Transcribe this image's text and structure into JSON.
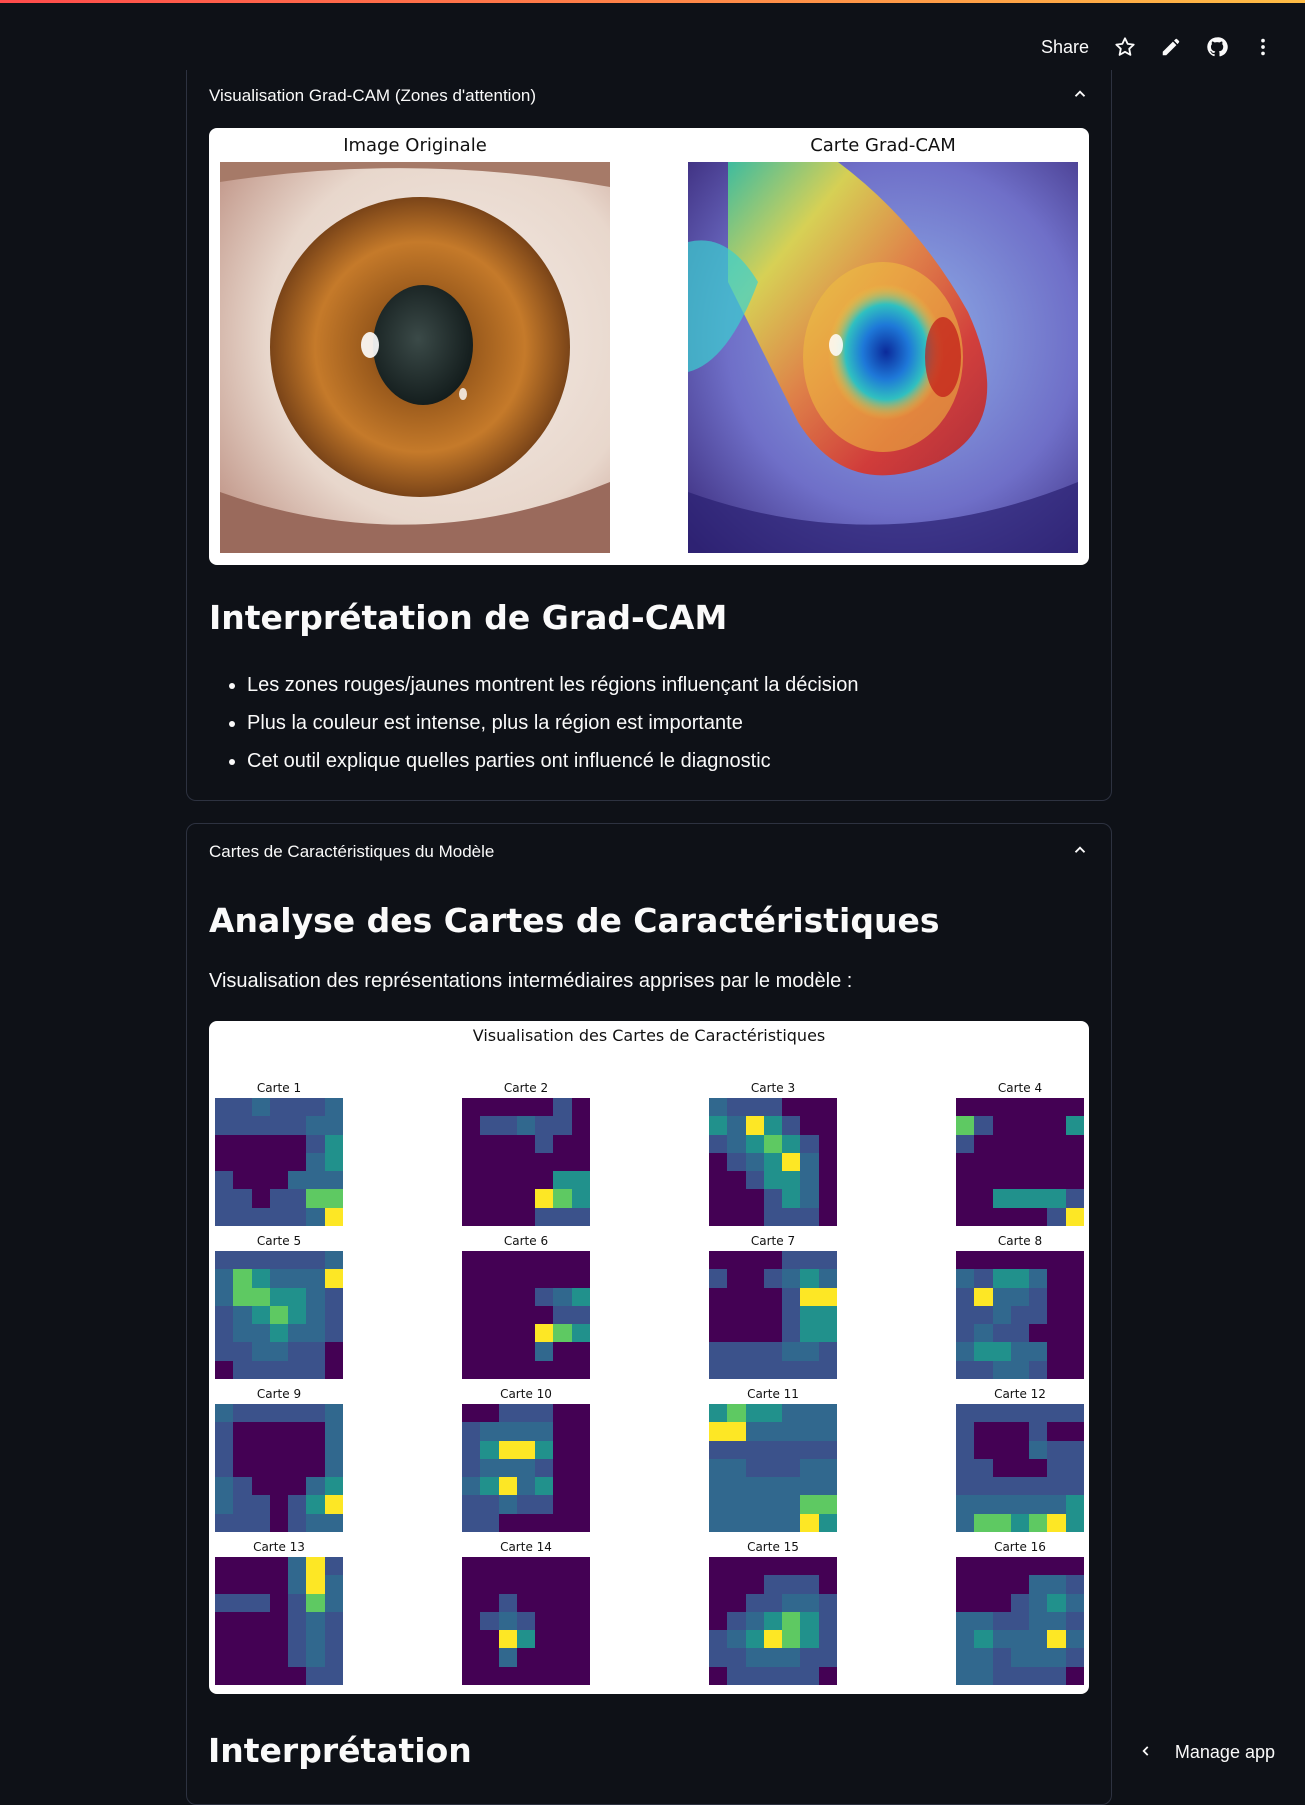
{
  "toolbar": {
    "share_label": "Share",
    "icons": [
      "star-icon",
      "pencil-icon",
      "github-icon",
      "more-vertical-icon"
    ]
  },
  "gradcam_expander": {
    "header": "Visualisation Grad-CAM (Zones d'attention)",
    "figure": {
      "left_title": "Image Originale",
      "right_title": "Carte Grad-CAM"
    },
    "heading": "Interprétation de Grad-CAM",
    "bullets": [
      "Les zones rouges/jaunes montrent les régions influençant la décision",
      "Plus la couleur est intense, plus la région est importante",
      "Cet outil explique quelles parties ont influencé le diagnostic"
    ]
  },
  "features_expander": {
    "header": "Cartes de Caractéristiques du Modèle",
    "heading": "Analyse des Cartes de Caractéristiques",
    "description": "Visualisation des représentations intermédiaires apprises par le modèle :",
    "figure_title": "Visualisation des Cartes de Caractéristiques",
    "maps": [
      {
        "label": "Carte 1",
        "cells": [
          1,
          1,
          2,
          1,
          1,
          1,
          2,
          1,
          1,
          1,
          1,
          1,
          2,
          2,
          0,
          0,
          0,
          0,
          0,
          1,
          3,
          0,
          0,
          0,
          0,
          0,
          2,
          3,
          1,
          0,
          0,
          0,
          2,
          2,
          2,
          1,
          1,
          0,
          1,
          1,
          4,
          4,
          1,
          1,
          1,
          1,
          1,
          2,
          5
        ]
      },
      {
        "label": "Carte 2",
        "cells": [
          0,
          0,
          0,
          0,
          0,
          1,
          0,
          0,
          1,
          1,
          2,
          1,
          1,
          0,
          0,
          0,
          0,
          0,
          1,
          0,
          0,
          0,
          0,
          0,
          0,
          0,
          0,
          0,
          0,
          0,
          0,
          0,
          0,
          3,
          3,
          0,
          0,
          0,
          0,
          5,
          4,
          3,
          0,
          0,
          0,
          0,
          1,
          1,
          1
        ]
      },
      {
        "label": "Carte 3",
        "cells": [
          2,
          1,
          1,
          1,
          0,
          0,
          0,
          3,
          2,
          5,
          3,
          1,
          0,
          0,
          1,
          2,
          3,
          4,
          3,
          1,
          0,
          0,
          1,
          2,
          3,
          5,
          2,
          0,
          0,
          0,
          1,
          3,
          3,
          2,
          0,
          0,
          0,
          0,
          1,
          3,
          2,
          0,
          0,
          0,
          0,
          1,
          1,
          1,
          0
        ]
      },
      {
        "label": "Carte 4",
        "cells": [
          0,
          0,
          0,
          0,
          0,
          0,
          0,
          4,
          1,
          0,
          0,
          0,
          0,
          3,
          1,
          0,
          0,
          0,
          0,
          0,
          0,
          0,
          0,
          0,
          0,
          0,
          0,
          0,
          0,
          0,
          0,
          0,
          0,
          0,
          0,
          0,
          0,
          3,
          3,
          3,
          3,
          1,
          0,
          0,
          0,
          0,
          0,
          1,
          5
        ]
      },
      {
        "label": "Carte 5",
        "cells": [
          1,
          1,
          1,
          1,
          1,
          1,
          2,
          2,
          4,
          3,
          2,
          2,
          2,
          5,
          2,
          4,
          4,
          3,
          3,
          2,
          1,
          1,
          2,
          3,
          4,
          3,
          2,
          1,
          1,
          2,
          2,
          3,
          2,
          2,
          1,
          1,
          1,
          2,
          2,
          1,
          1,
          0,
          0,
          1,
          1,
          1,
          1,
          1,
          0
        ]
      },
      {
        "label": "Carte 6",
        "cells": [
          0,
          0,
          0,
          0,
          0,
          0,
          0,
          0,
          0,
          0,
          0,
          0,
          0,
          0,
          0,
          0,
          0,
          0,
          1,
          2,
          3,
          0,
          0,
          0,
          0,
          0,
          1,
          1,
          0,
          0,
          0,
          0,
          5,
          4,
          3,
          0,
          0,
          0,
          0,
          2,
          0,
          0,
          0,
          0,
          0,
          0,
          0,
          0,
          0
        ]
      },
      {
        "label": "Carte 7",
        "cells": [
          0,
          0,
          0,
          0,
          1,
          1,
          1,
          1,
          0,
          0,
          1,
          2,
          3,
          2,
          0,
          0,
          0,
          0,
          1,
          5,
          5,
          0,
          0,
          0,
          0,
          1,
          3,
          3,
          0,
          0,
          0,
          0,
          1,
          3,
          3,
          1,
          1,
          1,
          1,
          2,
          2,
          1,
          1,
          1,
          1,
          1,
          1,
          1,
          1
        ]
      },
      {
        "label": "Carte 8",
        "cells": [
          0,
          0,
          0,
          0,
          0,
          0,
          0,
          2,
          1,
          3,
          3,
          2,
          0,
          0,
          1,
          5,
          2,
          2,
          1,
          0,
          0,
          1,
          1,
          2,
          1,
          1,
          0,
          0,
          1,
          2,
          1,
          1,
          0,
          0,
          0,
          2,
          3,
          3,
          2,
          2,
          0,
          0,
          1,
          1,
          2,
          2,
          1,
          0,
          0
        ]
      },
      {
        "label": "Carte 9",
        "cells": [
          2,
          1,
          1,
          1,
          1,
          1,
          2,
          1,
          0,
          0,
          0,
          0,
          0,
          2,
          1,
          0,
          0,
          0,
          0,
          0,
          2,
          1,
          0,
          0,
          0,
          0,
          0,
          2,
          2,
          1,
          0,
          0,
          0,
          2,
          3,
          2,
          1,
          1,
          0,
          1,
          3,
          5,
          1,
          1,
          1,
          0,
          1,
          2,
          2
        ]
      },
      {
        "label": "Carte 10",
        "cells": [
          0,
          0,
          1,
          1,
          1,
          0,
          0,
          1,
          2,
          2,
          2,
          2,
          0,
          0,
          1,
          3,
          5,
          5,
          3,
          0,
          0,
          1,
          2,
          2,
          2,
          1,
          0,
          0,
          2,
          3,
          5,
          2,
          3,
          0,
          0,
          1,
          1,
          2,
          1,
          1,
          0,
          0,
          1,
          1,
          0,
          0,
          0,
          0,
          0
        ]
      },
      {
        "label": "Carte 11",
        "cells": [
          3,
          4,
          3,
          3,
          2,
          2,
          2,
          5,
          5,
          2,
          2,
          2,
          2,
          2,
          1,
          1,
          1,
          1,
          1,
          1,
          1,
          2,
          2,
          1,
          1,
          1,
          2,
          2,
          2,
          2,
          2,
          2,
          2,
          2,
          2,
          2,
          2,
          2,
          2,
          2,
          4,
          4,
          2,
          2,
          2,
          2,
          2,
          5,
          3
        ]
      },
      {
        "label": "Carte 12",
        "cells": [
          1,
          1,
          1,
          1,
          1,
          1,
          1,
          1,
          0,
          0,
          0,
          1,
          0,
          0,
          1,
          0,
          0,
          0,
          2,
          1,
          1,
          1,
          1,
          0,
          0,
          0,
          1,
          1,
          1,
          1,
          1,
          1,
          1,
          1,
          1,
          2,
          2,
          2,
          2,
          2,
          2,
          3,
          2,
          4,
          4,
          3,
          4,
          5,
          3
        ]
      },
      {
        "label": "Carte 13",
        "cells": [
          0,
          0,
          0,
          0,
          2,
          5,
          1,
          0,
          0,
          0,
          0,
          2,
          5,
          2,
          1,
          1,
          1,
          0,
          1,
          4,
          2,
          0,
          0,
          0,
          0,
          1,
          2,
          1,
          0,
          0,
          0,
          0,
          1,
          2,
          1,
          0,
          0,
          0,
          0,
          1,
          2,
          1,
          0,
          0,
          0,
          0,
          0,
          1,
          1
        ]
      },
      {
        "label": "Carte 14",
        "cells": [
          0,
          0,
          0,
          0,
          0,
          0,
          0,
          0,
          0,
          0,
          0,
          0,
          0,
          0,
          0,
          0,
          1,
          0,
          0,
          0,
          0,
          0,
          1,
          2,
          1,
          0,
          0,
          0,
          0,
          0,
          5,
          3,
          0,
          0,
          0,
          0,
          0,
          2,
          0,
          0,
          0,
          0,
          0,
          0,
          0,
          0,
          0,
          0,
          0
        ]
      },
      {
        "label": "Carte 15",
        "cells": [
          0,
          0,
          0,
          0,
          0,
          0,
          0,
          0,
          0,
          0,
          1,
          1,
          1,
          0,
          0,
          0,
          1,
          1,
          2,
          2,
          1,
          0,
          1,
          2,
          3,
          4,
          3,
          1,
          1,
          2,
          3,
          5,
          4,
          3,
          1,
          1,
          1,
          2,
          2,
          2,
          1,
          1,
          0,
          1,
          1,
          1,
          1,
          1,
          0
        ]
      },
      {
        "label": "Carte 16",
        "cells": [
          0,
          0,
          0,
          0,
          0,
          0,
          0,
          0,
          0,
          0,
          0,
          2,
          2,
          1,
          0,
          0,
          0,
          1,
          2,
          3,
          2,
          2,
          2,
          1,
          1,
          2,
          2,
          1,
          2,
          3,
          2,
          2,
          2,
          5,
          2,
          2,
          2,
          1,
          2,
          2,
          2,
          1,
          2,
          2,
          1,
          1,
          1,
          1,
          0
        ]
      }
    ]
  },
  "next_heading": "Interprétation",
  "manage_app": {
    "label": "Manage app"
  },
  "colors": {
    "background": "#0e1117",
    "border": "#2d3240",
    "viridis": [
      "#440154",
      "#3b528b",
      "#31688e",
      "#21918c",
      "#5ec962",
      "#fde725"
    ]
  }
}
